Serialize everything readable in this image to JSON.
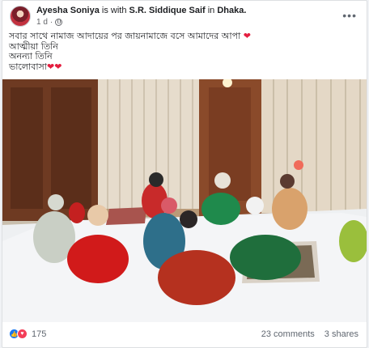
{
  "post": {
    "author": "Ayesha Soniya",
    "with_text": "is with",
    "tagged": "S.R. Siddique Saif",
    "in_text": "in",
    "location": "Dhaka.",
    "time": "1 d",
    "separator": "·",
    "privacy_icon": "globe-icon",
    "more_icon": "more-options-icon",
    "more_label": "•••",
    "text_lines": [
      "সবার সাথে নামাজ আদায়ের পর জায়নামাজে বসে আমাদের আপা",
      "আত্মীয়া তিনি",
      "অনন্যা তিনি",
      "ভালোবাসা"
    ],
    "heart_glyph": "❤"
  },
  "reactions": {
    "icons": [
      "like-icon",
      "love-icon"
    ],
    "like_glyph": "👍",
    "love_glyph": "♥",
    "count": "175",
    "comments": "23 comments",
    "shares": "3 shares"
  },
  "colors": {
    "link_blue": "#1877f2",
    "heart_red": "#e41e3f"
  }
}
